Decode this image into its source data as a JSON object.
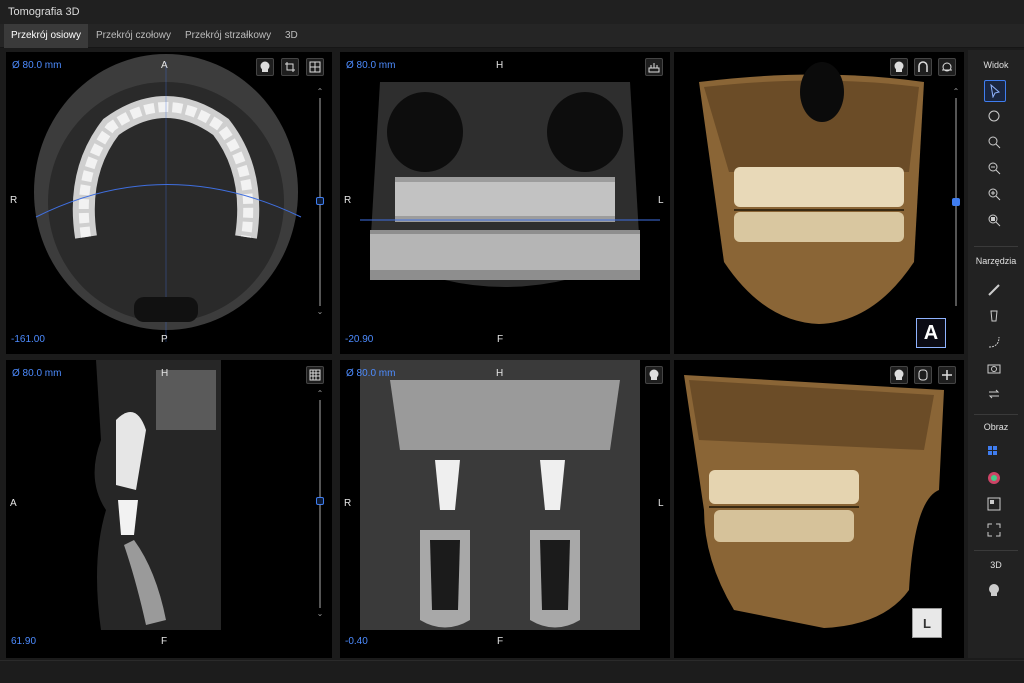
{
  "window": {
    "title": "Tomografia 3D"
  },
  "tabs": [
    {
      "label": "Przekrój osiowy",
      "active": true
    },
    {
      "label": "Przekrój czołowy",
      "active": false
    },
    {
      "label": "Przekrój strzałkowy",
      "active": false
    },
    {
      "label": "3D",
      "active": false
    }
  ],
  "panels": {
    "axial": {
      "diameter": "Ø 80.0 mm",
      "top": "A",
      "bottom": "P",
      "left": "R",
      "position": "-161.00",
      "icons": [
        "skull-icon",
        "crop-icon",
        "crosshair-icon"
      ]
    },
    "coronal": {
      "diameter": "Ø 80.0 mm",
      "top": "H",
      "bottom": "F",
      "left": "R",
      "right": "L",
      "position": "-20.90",
      "icons": [
        "ruler-icon"
      ]
    },
    "render_front": {
      "orientation_badge": "A",
      "icons": [
        "skull-icon",
        "head-outline-icon",
        "head-rotate-icon"
      ]
    },
    "sagittal": {
      "diameter": "Ø 80.0 mm",
      "top": "H",
      "bottom": "F",
      "left": "A",
      "position": "61.90",
      "icons": [
        "grid-icon"
      ]
    },
    "coronal2": {
      "diameter": "Ø 80.0 mm",
      "top": "H",
      "bottom": "F",
      "left": "R",
      "right": "L",
      "position": "-0.40",
      "icons": [
        "skull-icon"
      ]
    },
    "render_side": {
      "cube_label": "L",
      "icons": [
        "skull-icon",
        "head-front-icon",
        "clip-icon"
      ]
    }
  },
  "sidebar": {
    "sections": [
      {
        "title": "Widok",
        "tools": [
          "pointer-icon",
          "rotate-icon",
          "zoom-search-icon",
          "zoom-out-icon",
          "zoom-in-icon",
          "zoom-fit-icon"
        ]
      },
      {
        "title": "Narzędzia",
        "tools": [
          "ruler-icon",
          "implant-icon",
          "curve-icon",
          "camera-icon",
          "arrows-icon"
        ]
      },
      {
        "title": "Obraz",
        "tools": [
          "layout-grid-icon",
          "color-wheel-icon",
          "filter-icon",
          "expand-icon"
        ]
      },
      {
        "title": "3D",
        "tools": [
          "skull-3d-icon"
        ]
      }
    ]
  },
  "colors": {
    "accent": "#4d8cff",
    "bone": "#b68a4e",
    "panel_bg": "#000000"
  }
}
